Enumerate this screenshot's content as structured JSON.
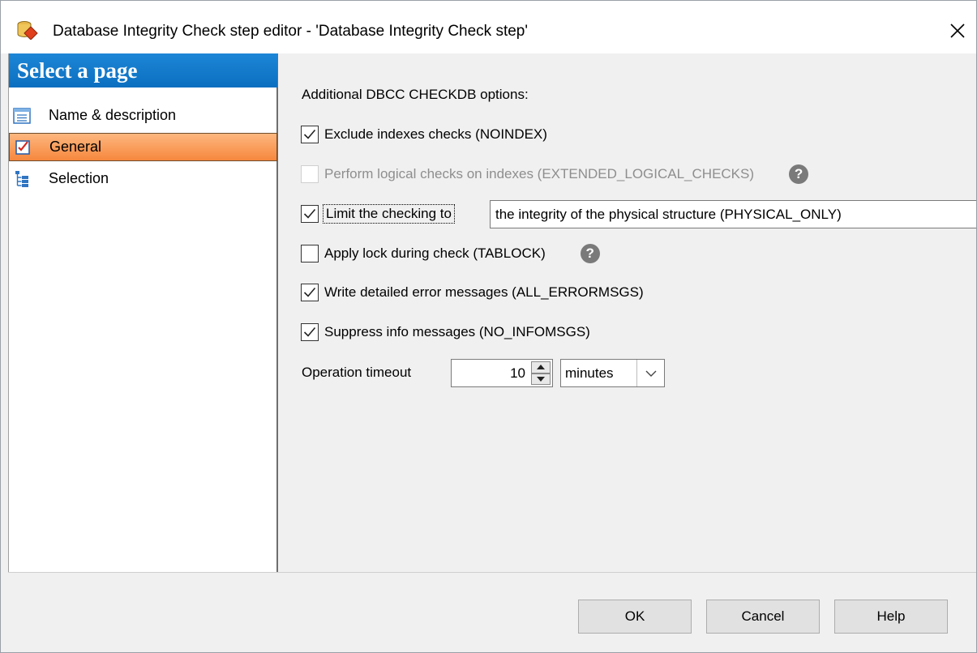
{
  "window": {
    "title": "Database Integrity Check step editor - 'Database Integrity Check step'"
  },
  "sidebar": {
    "header": "Select a page",
    "items": [
      {
        "label": "Name & description",
        "icon": "list-icon",
        "selected": false
      },
      {
        "label": "General",
        "icon": "checklist-icon",
        "selected": true
      },
      {
        "label": "Selection",
        "icon": "tree-icon",
        "selected": false
      }
    ]
  },
  "options": {
    "heading": "Additional DBCC CHECKDB options:",
    "noindex": {
      "label": "Exclude indexes checks (NOINDEX)",
      "checked": true
    },
    "extended_logical": {
      "label": "Perform logical checks on indexes (EXTENDED_LOGICAL_CHECKS)",
      "checked": false,
      "enabled": false
    },
    "limit": {
      "label": "Limit the checking to",
      "checked": true,
      "value": "the integrity of the physical structure (PHYSICAL_ONLY)"
    },
    "tablock": {
      "label": "Apply lock during check (TABLOCK)",
      "checked": false
    },
    "all_errormsgs": {
      "label": "Write detailed error messages (ALL_ERRORMSGS)",
      "checked": true
    },
    "no_infomsgs": {
      "label": "Suppress info messages (NO_INFOMSGS)",
      "checked": true
    },
    "help_glyph": "?"
  },
  "timeout": {
    "label": "Operation timeout",
    "value": "10",
    "unit": "minutes"
  },
  "buttons": {
    "ok": "OK",
    "cancel": "Cancel",
    "help": "Help"
  },
  "colors": {
    "sidebar_header": "#0b6fc0",
    "selected_item": "#f6873d"
  }
}
